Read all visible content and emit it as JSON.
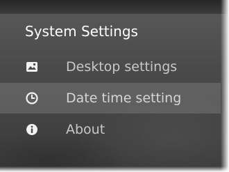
{
  "menu": {
    "title": "System Settings",
    "items": [
      {
        "label": "Desktop settings",
        "icon": "image-icon"
      },
      {
        "label": "Date time setting",
        "icon": "clock-icon"
      },
      {
        "label": "About",
        "icon": "info-icon"
      }
    ],
    "selected_index": 1
  },
  "colors": {
    "title_text": "#ffffff",
    "item_text": "#c8c8c8",
    "highlight": "#6a6a6a"
  }
}
